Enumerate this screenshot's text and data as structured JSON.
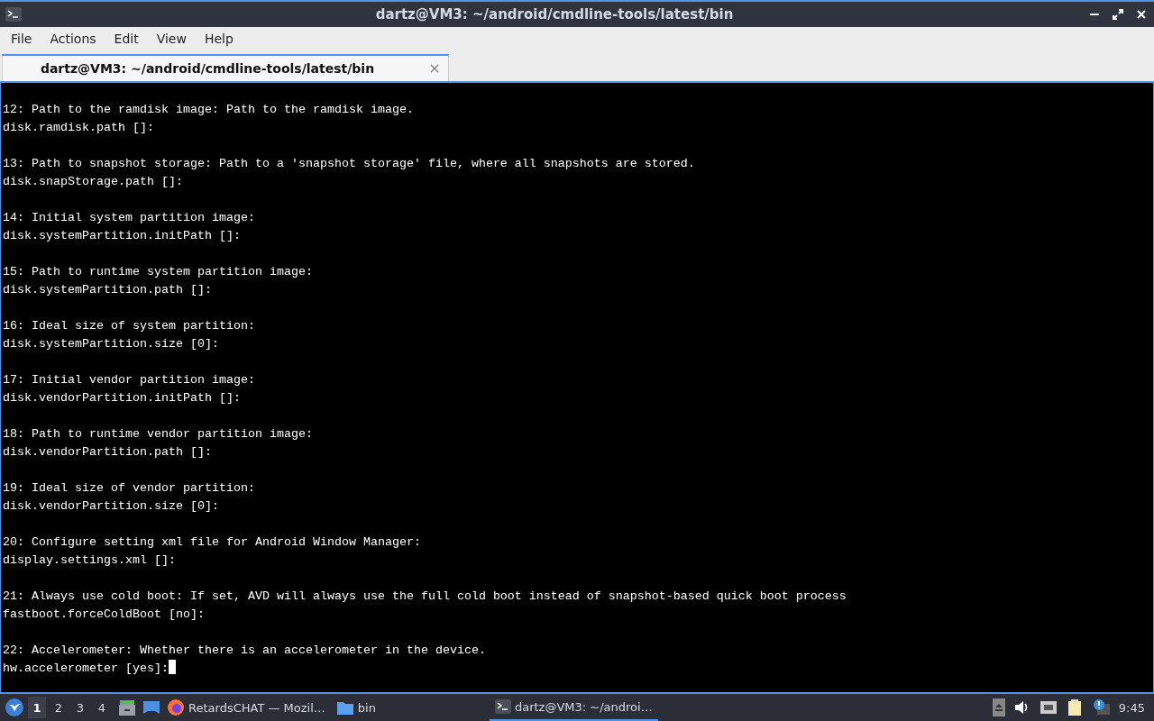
{
  "window": {
    "title": "dartz@VM3: ~/android/cmdline-tools/latest/bin"
  },
  "menu": [
    "File",
    "Actions",
    "Edit",
    "View",
    "Help"
  ],
  "tabs": [
    {
      "label": "dartz@VM3: ~/android/cmdline-tools/latest/bin",
      "selected": true
    }
  ],
  "terminal": {
    "entries": [
      {
        "description": "12: Path to the ramdisk image: Path to the ramdisk image.",
        "prompt": "disk.ramdisk.path []:"
      },
      {
        "description": "13: Path to snapshot storage: Path to a 'snapshot storage' file, where all snapshots are stored.",
        "prompt": "disk.snapStorage.path []:"
      },
      {
        "description": "14: Initial system partition image:",
        "prompt": "disk.systemPartition.initPath []:"
      },
      {
        "description": "15: Path to runtime system partition image:",
        "prompt": "disk.systemPartition.path []:"
      },
      {
        "description": "16: Ideal size of system partition:",
        "prompt": "disk.systemPartition.size [0]:"
      },
      {
        "description": "17: Initial vendor partition image:",
        "prompt": "disk.vendorPartition.initPath []:"
      },
      {
        "description": "18: Path to runtime vendor partition image:",
        "prompt": "disk.vendorPartition.path []:"
      },
      {
        "description": "19: Ideal size of vendor partition:",
        "prompt": "disk.vendorPartition.size [0]:"
      },
      {
        "description": "20: Configure setting xml file for Android Window Manager:",
        "prompt": "display.settings.xml []:"
      },
      {
        "description": "21: Always use cold boot: If set, AVD will always use the full cold boot instead of snapshot-based quick boot process",
        "prompt": "fastboot.forceColdBoot [no]:"
      },
      {
        "description": "22: Accelerometer: Whether there is an accelerometer in the device.",
        "prompt": "hw.accelerometer [yes]:"
      }
    ]
  },
  "taskbar": {
    "desktops": [
      {
        "label": "1",
        "selected": true
      },
      {
        "label": "2",
        "selected": false
      },
      {
        "label": "3",
        "selected": false
      },
      {
        "label": "4",
        "selected": false
      }
    ],
    "tasks": [
      {
        "kind": "browser",
        "label": "RetardsCHAT — Mozil…",
        "selected": false
      },
      {
        "kind": "folder",
        "label": "bin",
        "selected": false
      },
      {
        "kind": "terminal",
        "label": "dartz@VM3: ~/androi…",
        "selected": true
      }
    ],
    "clock": "9:45"
  }
}
